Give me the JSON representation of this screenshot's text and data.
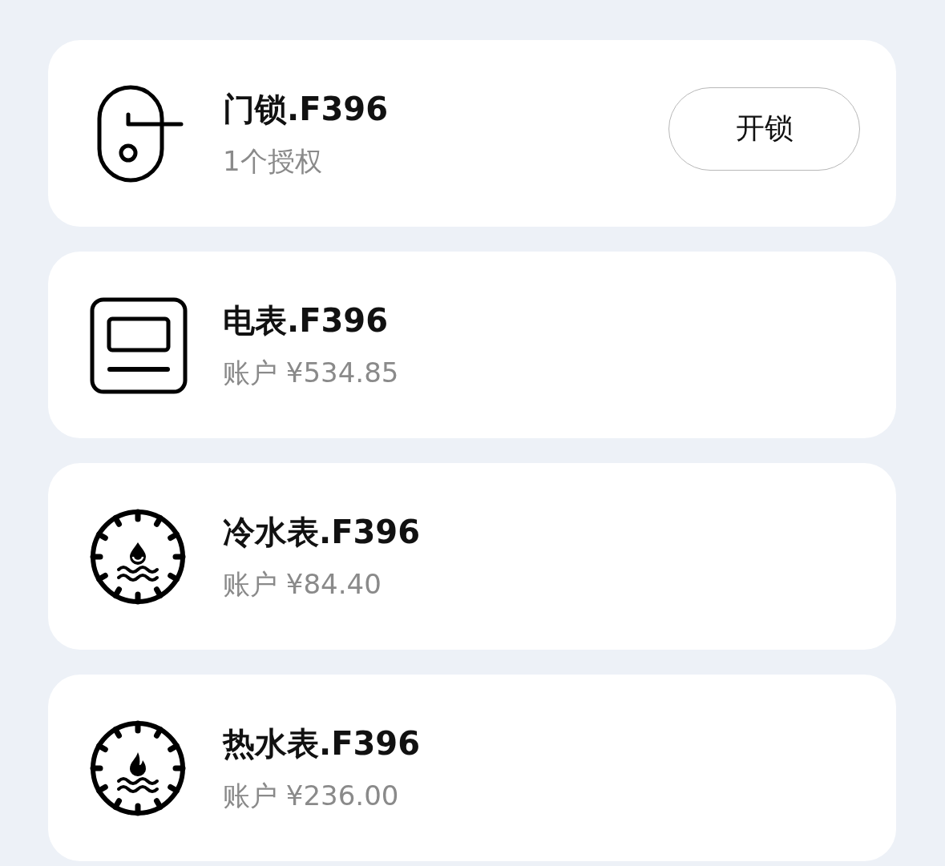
{
  "devices": [
    {
      "kind": "lock",
      "title": "门锁.F396",
      "subtitle": "1个授权",
      "button": "开锁"
    },
    {
      "kind": "electric",
      "title": "电表.F396",
      "subtitle": "账户 ¥534.85"
    },
    {
      "kind": "cold_water",
      "title": "冷水表.F396",
      "subtitle": "账户 ¥84.40"
    },
    {
      "kind": "hot_water",
      "title": "热水表.F396",
      "subtitle": "账户 ¥236.00"
    }
  ]
}
